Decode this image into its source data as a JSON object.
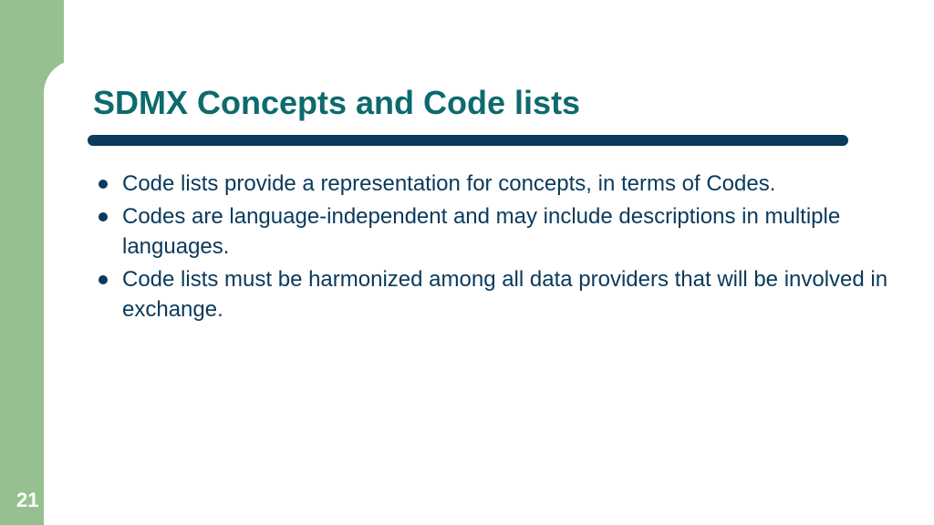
{
  "slide": {
    "title": "SDMX Concepts and Code lists",
    "bullets": [
      "Code lists provide a representation for concepts, in terms of Codes.",
      "Codes are language-independent and may include descriptions in multiple languages.",
      "Code lists must be harmonized among all data providers that will be involved in exchange."
    ],
    "pageNumber": "21"
  }
}
